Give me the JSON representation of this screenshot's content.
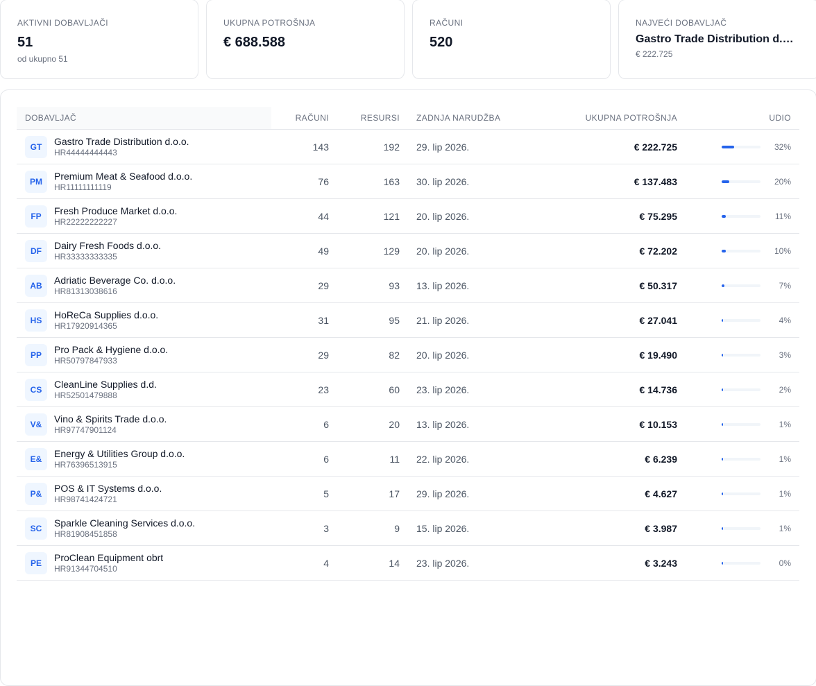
{
  "summary": {
    "active": {
      "label": "AKTIVNI DOBAVLJAČI",
      "value": "51",
      "sub": "od ukupno 51"
    },
    "spend": {
      "label": "UKUPNA POTROŠNJA",
      "value": "€ 688.588"
    },
    "invoices": {
      "label": "RAČUNI",
      "value": "520"
    },
    "top": {
      "label": "NAJVEĆI DOBAVLJAČ",
      "value": "Gastro Trade Distribution d.o.o.",
      "sub": "€ 222.725"
    }
  },
  "table": {
    "headers": {
      "supplier": "DOBAVLJAČ",
      "invoices": "RAČUNI",
      "resources": "RESURSI",
      "last_order": "ZADNJA NARUDŽBA",
      "total_spend": "UKUPNA POTROŠNJA",
      "share": "UDIO"
    },
    "rows": [
      {
        "initials": "GT",
        "name": "Gastro Trade Distribution d.o.o.",
        "vat": "HR44444444443",
        "invoices": "143",
        "resources": "192",
        "last_order": "29. lip 2026.",
        "spend": "€ 222.725",
        "share": "32%",
        "share_value": 32.3
      },
      {
        "initials": "PM",
        "name": "Premium Meat & Seafood d.o.o.",
        "vat": "HR11111111119",
        "invoices": "76",
        "resources": "163",
        "last_order": "30. lip 2026.",
        "spend": "€ 137.483",
        "share": "20%",
        "share_value": 20.0
      },
      {
        "initials": "FP",
        "name": "Fresh Produce Market d.o.o.",
        "vat": "HR22222222227",
        "invoices": "44",
        "resources": "121",
        "last_order": "20. lip 2026.",
        "spend": "€ 75.295",
        "share": "11%",
        "share_value": 10.9
      },
      {
        "initials": "DF",
        "name": "Dairy Fresh Foods d.o.o.",
        "vat": "HR33333333335",
        "invoices": "49",
        "resources": "129",
        "last_order": "20. lip 2026.",
        "spend": "€ 72.202",
        "share": "10%",
        "share_value": 10.5
      },
      {
        "initials": "AB",
        "name": "Adriatic Beverage Co. d.o.o.",
        "vat": "HR81313038616",
        "invoices": "29",
        "resources": "93",
        "last_order": "13. lip 2026.",
        "spend": "€ 50.317",
        "share": "7%",
        "share_value": 7.3
      },
      {
        "initials": "HS",
        "name": "HoReCa Supplies d.o.o.",
        "vat": "HR17920914365",
        "invoices": "31",
        "resources": "95",
        "last_order": "21. lip 2026.",
        "spend": "€ 27.041",
        "share": "4%",
        "share_value": 3.9
      },
      {
        "initials": "PP",
        "name": "Pro Pack & Hygiene d.o.o.",
        "vat": "HR50797847933",
        "invoices": "29",
        "resources": "82",
        "last_order": "20. lip 2026.",
        "spend": "€ 19.490",
        "share": "3%",
        "share_value": 2.8
      },
      {
        "initials": "CS",
        "name": "CleanLine Supplies d.d.",
        "vat": "HR52501479888",
        "invoices": "23",
        "resources": "60",
        "last_order": "23. lip 2026.",
        "spend": "€ 14.736",
        "share": "2%",
        "share_value": 2.1
      },
      {
        "initials": "V&",
        "name": "Vino & Spirits Trade d.o.o.",
        "vat": "HR97747901124",
        "invoices": "6",
        "resources": "20",
        "last_order": "13. lip 2026.",
        "spend": "€ 10.153",
        "share": "1%",
        "share_value": 1.5
      },
      {
        "initials": "E&",
        "name": "Energy & Utilities Group d.o.o.",
        "vat": "HR76396513915",
        "invoices": "6",
        "resources": "11",
        "last_order": "22. lip 2026.",
        "spend": "€ 6.239",
        "share": "1%",
        "share_value": 0.9
      },
      {
        "initials": "P&",
        "name": "POS & IT Systems d.o.o.",
        "vat": "HR98741424721",
        "invoices": "5",
        "resources": "17",
        "last_order": "29. lip 2026.",
        "spend": "€ 4.627",
        "share": "1%",
        "share_value": 0.7
      },
      {
        "initials": "SC",
        "name": "Sparkle Cleaning Services d.o.o.",
        "vat": "HR81908451858",
        "invoices": "3",
        "resources": "9",
        "last_order": "15. lip 2026.",
        "spend": "€ 3.987",
        "share": "1%",
        "share_value": 0.6
      },
      {
        "initials": "PE",
        "name": "ProClean Equipment obrt",
        "vat": "HR91344704510",
        "invoices": "4",
        "resources": "14",
        "last_order": "23. lip 2026.",
        "spend": "€ 3.243",
        "share": "0%",
        "share_value": 0.5
      }
    ]
  },
  "colors": {
    "accent": "#2563eb",
    "avatar_bg": "#eff6ff",
    "border": "#e5e7eb",
    "muted": "#6b7280"
  }
}
